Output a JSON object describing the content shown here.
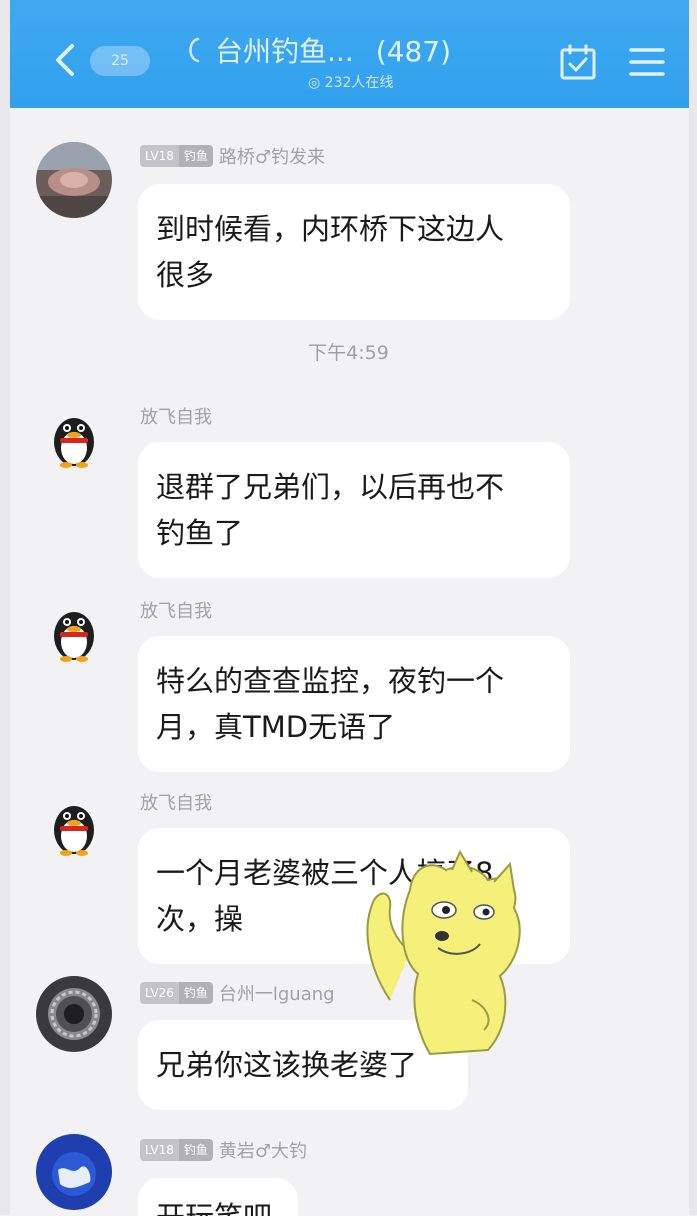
{
  "header": {
    "unread_count": "25",
    "title": "台州钓鱼...",
    "member_count": "(487)",
    "online": "232人在线"
  },
  "timestamp": "下午4:59",
  "messages": [
    {
      "level": "LV18",
      "title": "钓鱼",
      "sender": "路桥♂钓发来",
      "text_lines": [
        "到时候看，内环桥下这边人",
        "很多"
      ]
    },
    {
      "sender": "放飞自我",
      "text_lines": [
        "退群了兄弟们，以后再也不",
        "钓鱼了"
      ]
    },
    {
      "sender": "放飞自我",
      "text_lines": [
        "特么的查查监控，夜钓一个",
        "月，真TMD无语了"
      ]
    },
    {
      "sender": "放飞自我",
      "text_lines": [
        "一个月老婆被三个人搞了8",
        "次，操"
      ]
    },
    {
      "level": "LV26",
      "title": "钓鱼",
      "sender": "台州一lguang",
      "text_lines": [
        "兄弟你这该换老婆了"
      ]
    },
    {
      "level": "LV18",
      "title": "钓鱼",
      "sender": "黄岩♂大钓",
      "text_lines": [
        "开玩笑吧"
      ]
    }
  ],
  "colors": {
    "header": "#31a0ee",
    "background": "#f2f2f4",
    "bubble": "#ffffff"
  }
}
